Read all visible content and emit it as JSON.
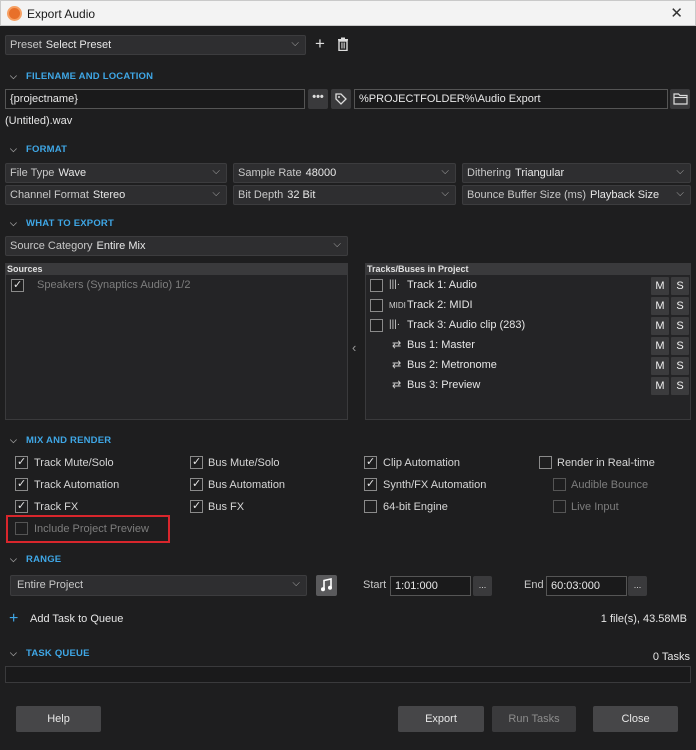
{
  "window": {
    "title": "Export Audio",
    "close_glyph": "✕"
  },
  "preset": {
    "label": "Preset",
    "value": "Select Preset"
  },
  "sections": {
    "filename_location": "FILENAME AND LOCATION",
    "format": "FORMAT",
    "what_to_export": "WHAT TO EXPORT",
    "mix_render": "MIX AND RENDER",
    "range": "RANGE",
    "task_queue": "TASK QUEUE"
  },
  "filename": {
    "value": "{projectname}",
    "preview": "(Untitled).wav",
    "path": "%PROJECTFOLDER%\\Audio Export"
  },
  "format": {
    "file_type": {
      "label": "File Type",
      "value": "Wave"
    },
    "sample_rate": {
      "label": "Sample Rate",
      "value": "48000"
    },
    "dithering": {
      "label": "Dithering",
      "value": "Triangular"
    },
    "channel_format": {
      "label": "Channel Format",
      "value": "Stereo"
    },
    "bit_depth": {
      "label": "Bit Depth",
      "value": "32 Bit"
    },
    "bounce_buffer": {
      "label": "Bounce Buffer Size (ms)",
      "value": "Playback Size"
    }
  },
  "export": {
    "source_category": {
      "label": "Source Category",
      "value": "Entire Mix"
    },
    "sources_header": "Sources",
    "sources": [
      {
        "name": "Speakers (Synaptics Audio) 1/2",
        "checked": true
      }
    ],
    "tracks_header": "Tracks/Buses in Project",
    "tracks": [
      {
        "name": "Track 1: Audio",
        "icon": "audio-waveform-icon",
        "glyph": "|||·"
      },
      {
        "name": "Track 2: MIDI",
        "icon": "midi-icon",
        "glyph": "MIDI"
      },
      {
        "name": "Track 3: Audio clip (283)",
        "icon": "audio-clip-icon",
        "glyph": "|||·"
      },
      {
        "name": "Bus 1: Master",
        "icon": "bus-icon",
        "glyph": "⇄"
      },
      {
        "name": "Bus 2: Metronome",
        "icon": "bus-icon",
        "glyph": "⇄"
      },
      {
        "name": "Bus 3: Preview",
        "icon": "bus-icon",
        "glyph": "⇄"
      }
    ],
    "mute_label": "M",
    "solo_label": "S"
  },
  "mix": {
    "track_mute_solo": {
      "label": "Track Mute/Solo",
      "checked": true
    },
    "bus_mute_solo": {
      "label": "Bus Mute/Solo",
      "checked": true
    },
    "clip_automation": {
      "label": "Clip Automation",
      "checked": true
    },
    "render_realtime": {
      "label": "Render in Real-time",
      "checked": false
    },
    "track_automation": {
      "label": "Track Automation",
      "checked": true
    },
    "bus_automation": {
      "label": "Bus Automation",
      "checked": true
    },
    "synth_fx_automation": {
      "label": "Synth/FX Automation",
      "checked": true
    },
    "audible_bounce": {
      "label": "Audible Bounce",
      "checked": false
    },
    "track_fx": {
      "label": "Track FX",
      "checked": true
    },
    "bus_fx": {
      "label": "Bus FX",
      "checked": true
    },
    "engine_64bit": {
      "label": "64-bit Engine",
      "checked": false
    },
    "live_input": {
      "label": "Live Input",
      "checked": false
    },
    "include_preview": {
      "label": "Include Project Preview",
      "checked": false
    }
  },
  "range": {
    "value": "Entire Project",
    "start_label": "Start",
    "start_value": "1:01:000",
    "end_label": "End",
    "end_value": "60:03:000",
    "ellipsis": "..."
  },
  "queue": {
    "add_label": "Add Task to Queue",
    "file_info": "1 file(s), 43.58MB",
    "tasks_count": "0 Tasks"
  },
  "buttons": {
    "help": "Help",
    "export": "Export",
    "run_tasks": "Run Tasks",
    "close": "Close"
  },
  "colors": {
    "accent": "#3fa7e6",
    "highlight_box": "#d9262c",
    "app_icon": "#e8702a"
  }
}
